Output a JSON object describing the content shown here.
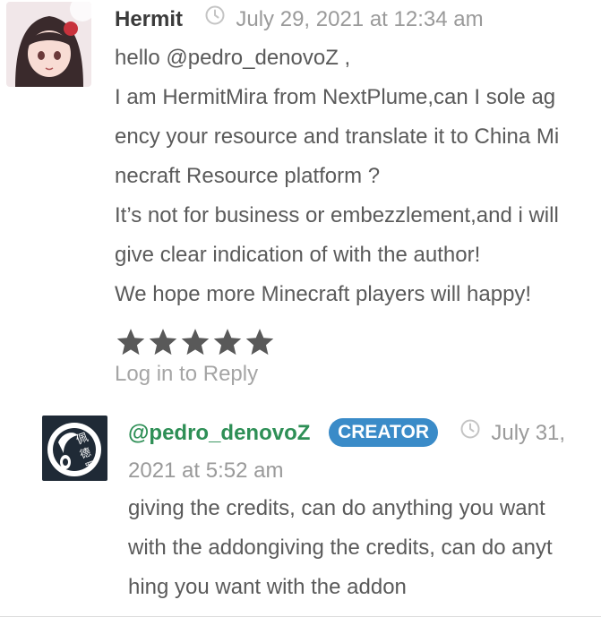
{
  "comments": [
    {
      "author": "Hermit",
      "date": "July 29, 2021 at 12:34 am",
      "body": [
        "hello @pedro_denovoZ ,",
        "I am HermitMira from NextPlume,can I sole ag",
        "ency your resource and translate it to China Mi",
        "necraft Resource platform ?",
        "It’s not for business or embezzlement,and i will",
        "give clear indication of with the author!",
        "We hope more Minecraft players will happy!"
      ],
      "rating": 5,
      "reply_label": "Log in to Reply"
    }
  ],
  "reply": {
    "author": "@pedro_denovoZ",
    "badge": "CREATOR",
    "date_line1": "July 31,",
    "date_line2": "2021 at 5:52 am",
    "body": [
      "giving the credits, can do anything you want",
      "with the addongiving the credits, can do anyt",
      "hing you want with the addon"
    ]
  },
  "colors": {
    "star": "#595959",
    "accent": "#3a8bc8",
    "reply_author": "#2e8f56"
  }
}
